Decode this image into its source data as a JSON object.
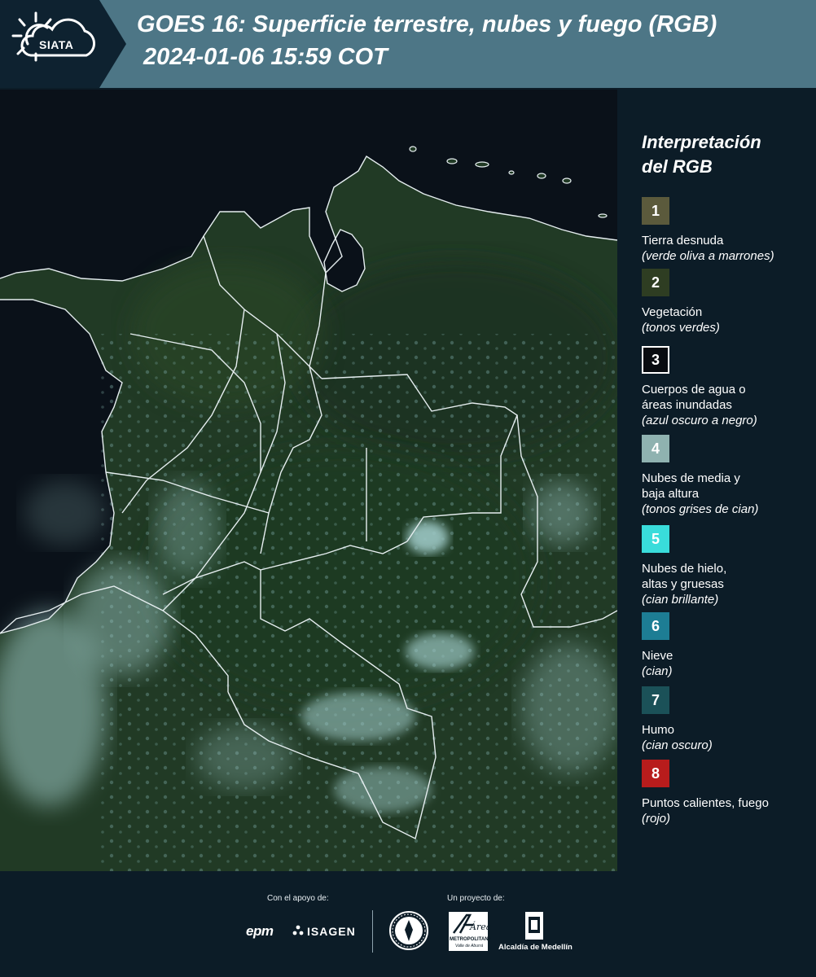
{
  "header": {
    "logo_text": "SIATA",
    "title_line1": "GOES 16: Superficie terrestre, nubes y fuego (RGB)",
    "title_line2": "2024-01-06 15:59 COT"
  },
  "legend": {
    "title_line1": "Interpretación",
    "title_line2": "del RGB",
    "items": [
      {
        "number": "1",
        "color": "#5b5a3c",
        "label": [
          "Tierra desnuda"
        ],
        "sub": "(verde oliva a marrones)"
      },
      {
        "number": "2",
        "color": "#2e3d22",
        "label": [
          "Vegetación"
        ],
        "sub": "(tonos verdes)"
      },
      {
        "number": "3",
        "color": "#080b10",
        "label": [
          "Cuerpos de agua o",
          "áreas inundadas"
        ],
        "sub": "(azul oscuro a negro)"
      },
      {
        "number": "4",
        "color": "#8fb2b0",
        "label": [
          "Nubes de media y",
          "baja altura"
        ],
        "sub": "(tonos grises de cian)"
      },
      {
        "number": "5",
        "color": "#39dcdb",
        "label": [
          "Nubes de hielo,",
          "altas y gruesas"
        ],
        "sub": "(cian brillante)"
      },
      {
        "number": "6",
        "color": "#1d7d94",
        "label": [
          "Nieve"
        ],
        "sub": "(cian)"
      },
      {
        "number": "7",
        "color": "#1b5158",
        "label": [
          "Humo"
        ],
        "sub": "(cian oscuro)"
      },
      {
        "number": "8",
        "color": "#b81c1c",
        "label": [
          "Puntos calientes, fuego"
        ],
        "sub": "(rojo)"
      }
    ]
  },
  "footer": {
    "support_label": "Con el apoyo de:",
    "project_label": "Un proyecto de:",
    "sponsors": [
      "epm",
      "ISAGEN"
    ],
    "partners": [
      "METROPOLITANA",
      "Alcaldía de Medellín"
    ],
    "partner_script_text": "Área",
    "partner_subtitle": "Valle de Aburrá"
  },
  "colors": {
    "header_bg": "#4d7686",
    "logo_bg": "#0e2230",
    "page_bg": "#0c1c27",
    "land": "#213a25",
    "ocean": "#0a1119",
    "cloud": "#9cc7c4",
    "border_line": "#e6eef0"
  }
}
